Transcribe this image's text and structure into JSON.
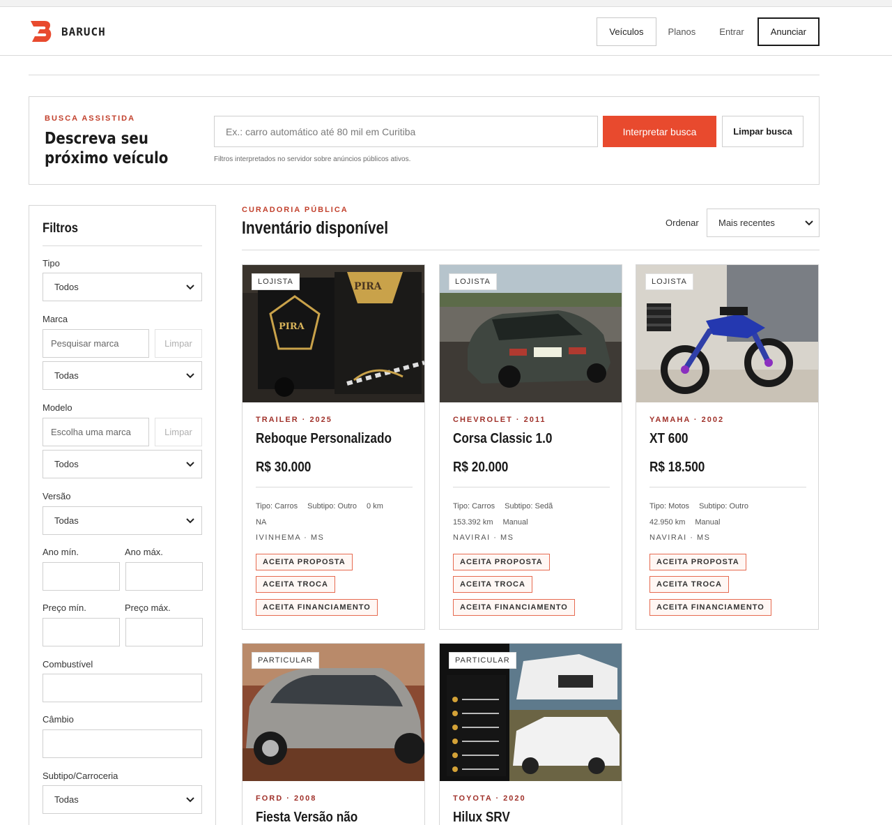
{
  "header": {
    "brand": "BARUCH",
    "nav": [
      "Veículos",
      "Planos",
      "Entrar",
      "Anunciar"
    ]
  },
  "search": {
    "eyebrow": "BUSCA ASSISTIDA",
    "title": "Descreva seu próximo veículo",
    "placeholder": "Ex.: carro automático até 80 mil em Curitiba",
    "interpret_label": "Interpretar busca",
    "clear_label": "Limpar busca",
    "hint": "Filtros interpretados no servidor sobre anúncios públicos ativos."
  },
  "filters": {
    "title": "Filtros",
    "tipo_label": "Tipo",
    "tipo_value": "Todos",
    "marca_label": "Marca",
    "marca_placeholder": "Pesquisar marca",
    "clear_label": "Limpar",
    "marca_value": "Todas",
    "modelo_label": "Modelo",
    "modelo_placeholder": "Escolha uma marca",
    "modelo_value": "Todos",
    "versao_label": "Versão",
    "versao_value": "Todas",
    "ano_min_label": "Ano mín.",
    "ano_max_label": "Ano máx.",
    "preco_min_label": "Preço mín.",
    "preco_max_label": "Preço máx.",
    "combustivel_label": "Combustível",
    "cambio_label": "Câmbio",
    "subtipo_label": "Subtipo/Carroceria",
    "subtipo_value": "Todas"
  },
  "inventory": {
    "eyebrow": "CURADORIA PÚBLICA",
    "title": "Inventário disponível",
    "sort_label": "Ordenar",
    "sort_value": "Mais recentes"
  },
  "cards": [
    {
      "badge": "LOJISTA",
      "eyebrow": "TRAILER · 2025",
      "title": "Reboque Personalizado",
      "price": "R$ 30.000",
      "spec1": [
        "Tipo: Carros",
        "Subtipo: Outro",
        "0 km"
      ],
      "spec2": [
        "NA"
      ],
      "location": "IVINHEMA · MS",
      "tags": [
        "ACEITA PROPOSTA",
        "ACEITA TROCA",
        "ACEITA FINANCIAMENTO"
      ],
      "image_icon": "food-trailer-photo"
    },
    {
      "badge": "LOJISTA",
      "eyebrow": "CHEVROLET · 2011",
      "title": "Corsa Classic 1.0",
      "price": "R$ 20.000",
      "spec1": [
        "Tipo: Carros",
        "Subtipo: Sedã"
      ],
      "spec2": [
        "153.392 km",
        "Manual"
      ],
      "location": "NAVIRAI · MS",
      "tags": [
        "ACEITA PROPOSTA",
        "ACEITA TROCA",
        "ACEITA FINANCIAMENTO"
      ],
      "image_icon": "sedan-photo"
    },
    {
      "badge": "LOJISTA",
      "eyebrow": "YAMAHA · 2002",
      "title": "XT 600",
      "price": "R$ 18.500",
      "spec1": [
        "Tipo: Motos",
        "Subtipo: Outro"
      ],
      "spec2": [
        "42.950 km",
        "Manual"
      ],
      "location": "NAVIRAI · MS",
      "tags": [
        "ACEITA PROPOSTA",
        "ACEITA TROCA",
        "ACEITA FINANCIAMENTO"
      ],
      "image_icon": "motorcycle-photo"
    },
    {
      "badge": "PARTICULAR",
      "eyebrow": "FORD · 2008",
      "title": "Fiesta Versão não",
      "image_icon": "hatchback-photo"
    },
    {
      "badge": "PARTICULAR",
      "eyebrow": "TOYOTA · 2020",
      "title": "Hilux SRV",
      "image_icon": "pickup-photo"
    }
  ],
  "colors": {
    "accent": "#e84a2e",
    "eyebrow": "#c2412d",
    "border": "#d6d6d6"
  }
}
